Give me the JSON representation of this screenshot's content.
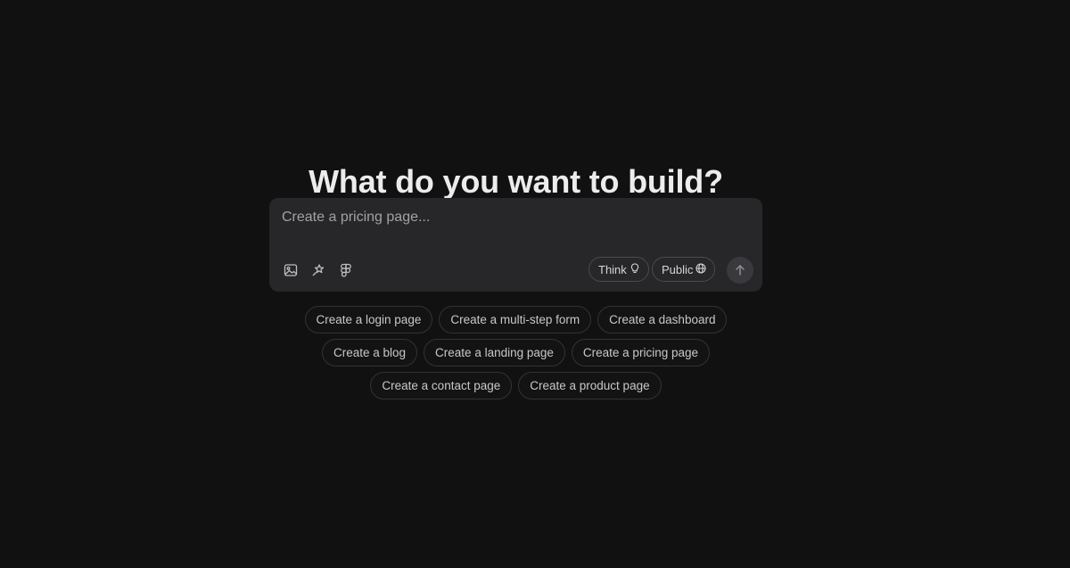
{
  "heading": "What do you want to build?",
  "composer": {
    "placeholder": "Create a pricing page...",
    "tools": [
      {
        "icon": "image-icon"
      },
      {
        "icon": "magic-wand-icon"
      },
      {
        "icon": "figma-icon"
      }
    ],
    "think_label": "Think",
    "public_label": "Public",
    "send_icon": "arrow-up-icon"
  },
  "suggestions": [
    [
      "Create a login page",
      "Create a multi-step form",
      "Create a dashboard"
    ],
    [
      "Create a blog",
      "Create a landing page",
      "Create a pricing page"
    ],
    [
      "Create a contact page",
      "Create a product page"
    ]
  ],
  "colors": {
    "background": "#111111",
    "composer": "#27272a",
    "text": "#ececec",
    "muted": "#a1a1a6"
  }
}
